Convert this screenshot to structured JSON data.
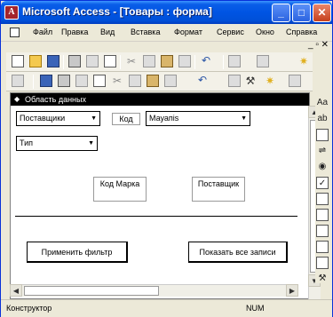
{
  "titlebar": {
    "app_icon": "access-icon",
    "title": "Microsoft Access - [Товары : форма]",
    "minimize": "_",
    "maximize": "□",
    "close": "✕"
  },
  "menubar": {
    "items": [
      "Файл",
      "Правка",
      "Вид",
      "Вставка",
      "Формат",
      "Сервис",
      "Окно",
      "Справка"
    ],
    "close_glyph": "✕",
    "restore_glyph": "_ ▫ ✕"
  },
  "form": {
    "section_header": "Область данных",
    "combo_suppliers": "Поставщики",
    "label_code": "Код",
    "combo_value": "Мауапis",
    "combo_type": "Тип",
    "label_code_brand": "Код Марка",
    "label_supplier": "Поставщик",
    "button_apply": "Применить фильтр",
    "button_show_all": "Показать все записи"
  },
  "statusbar": {
    "mode": "Конструктор",
    "num": "NUM"
  },
  "colors": {
    "titlebar": "#0054e3",
    "window_bg": "#ece9d8",
    "section_header": "#000000"
  }
}
